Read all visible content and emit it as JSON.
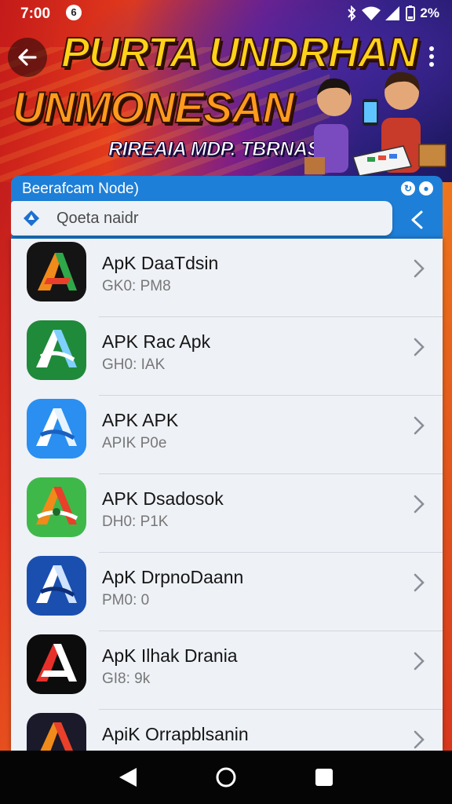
{
  "status_bar": {
    "time": "7:00",
    "notification_glyph": "6",
    "battery_text": "2%"
  },
  "banner": {
    "title_line_1": "PURTA UNDRHAN",
    "title_line_2": "UNMONESAN",
    "subtitle": "RIREAIA MDP. TBRNAS"
  },
  "search": {
    "heading": "Beerafcam Node)",
    "placeholder": "Qoeta naidr"
  },
  "apps": [
    {
      "name": "ApK DaaTdsin",
      "sub": "GK0: PM8",
      "icon": "dark-a-logo"
    },
    {
      "name": "APK Rac Apk",
      "sub": "GH0: IAK",
      "icon": "green-a-logo"
    },
    {
      "name": "APK APK",
      "sub": "APIK P0e",
      "icon": "blue-a-logo"
    },
    {
      "name": "APK Dsadosok",
      "sub": "DH0: P1K",
      "icon": "lightgreen-a-logo"
    },
    {
      "name": "ApK DrpnoDaann",
      "sub": "PM0: 0",
      "icon": "navy-a-logo"
    },
    {
      "name": "ApK Ilhak Drania",
      "sub": "GI8: 9k",
      "icon": "black-red-a-logo"
    },
    {
      "name": "ApiK Orrapblsanin",
      "sub": "",
      "icon": "dark-orange-a-logo"
    }
  ],
  "colors": {
    "accent": "#1e7fd8",
    "list_bg": "#eef1f6",
    "nav_bg": "#050505"
  },
  "icons": {
    "back": "arrow-left-icon",
    "more": "more-vertical-icon",
    "collapse": "chevron-left-icon",
    "nav_back": "triangle-back-icon",
    "nav_home": "circle-home-icon",
    "nav_recents": "square-recents-icon"
  }
}
